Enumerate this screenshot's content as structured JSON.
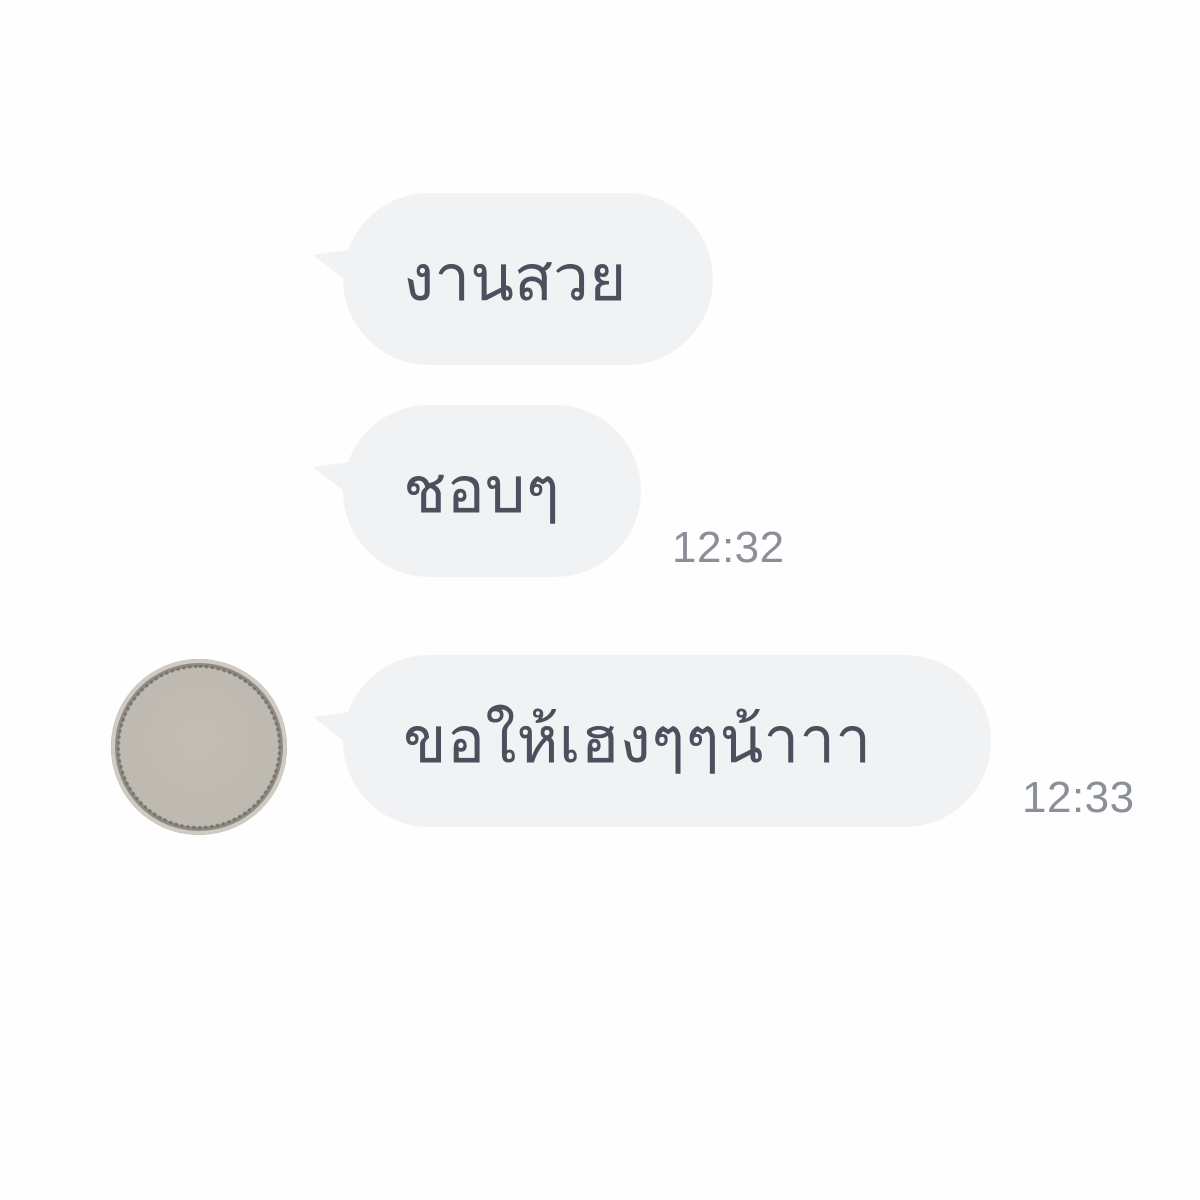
{
  "chat": {
    "messages": [
      {
        "text": "งานสวย",
        "time": ""
      },
      {
        "text": "ชอบๆ",
        "time": "12:32"
      },
      {
        "text": "ขอให้เฮงๆๆน้าาา",
        "time": "12:33"
      }
    ]
  },
  "colors": {
    "background": "#fefefe",
    "bubble": "#f0f2f4",
    "text": "#4a515d",
    "timestamp": "#8b9098"
  },
  "icons": {
    "avatar": "user-avatar-blurred"
  }
}
